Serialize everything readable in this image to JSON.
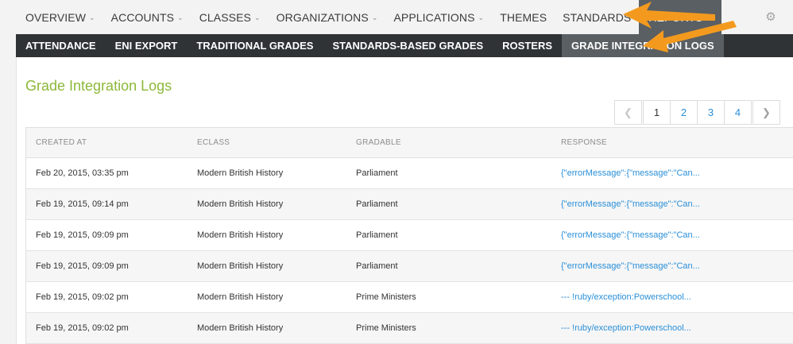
{
  "top_nav": {
    "items": [
      {
        "label": "OVERVIEW",
        "chevron": true
      },
      {
        "label": "ACCOUNTS",
        "chevron": true
      },
      {
        "label": "CLASSES",
        "chevron": true
      },
      {
        "label": "ORGANIZATIONS",
        "chevron": true
      },
      {
        "label": "APPLICATIONS",
        "chevron": true
      },
      {
        "label": "THEMES",
        "chevron": false
      },
      {
        "label": "STANDARDS",
        "chevron": false
      },
      {
        "label": "REPORTS",
        "chevron": true,
        "active": true
      }
    ],
    "settings_icon": "gear-icon"
  },
  "sub_nav": {
    "items": [
      {
        "label": "ATTENDANCE"
      },
      {
        "label": "ENI EXPORT"
      },
      {
        "label": "TRADITIONAL GRADES"
      },
      {
        "label": "STANDARDS-BASED GRADES"
      },
      {
        "label": "ROSTERS"
      },
      {
        "label": "GRADE INTEGRATION LOGS",
        "active": true
      }
    ]
  },
  "page": {
    "title": "Grade Integration Logs"
  },
  "pagination": {
    "prev_icon": "chevron-left-icon",
    "pages": [
      "1",
      "2",
      "3",
      "4"
    ],
    "current": "1",
    "next_icon": "chevron-right-icon"
  },
  "table": {
    "headers": [
      "CREATED AT",
      "ECLASS",
      "GRADABLE",
      "RESPONSE"
    ],
    "rows": [
      [
        "Feb 20, 2015, 03:35 pm",
        "Modern British History",
        "Parliament",
        "{\"errorMessage\":{\"message\":\"Can..."
      ],
      [
        "Feb 19, 2015, 09:14 pm",
        "Modern British History",
        "Parliament",
        "{\"errorMessage\":{\"message\":\"Can..."
      ],
      [
        "Feb 19, 2015, 09:09 pm",
        "Modern British History",
        "Parliament",
        "{\"errorMessage\":{\"message\":\"Can..."
      ],
      [
        "Feb 19, 2015, 09:09 pm",
        "Modern British History",
        "Parliament",
        "{\"errorMessage\":{\"message\":\"Can..."
      ],
      [
        "Feb 19, 2015, 09:02 pm",
        "Modern British History",
        "Prime Ministers",
        "--- !ruby/exception:Powerschool..."
      ],
      [
        "Feb 19, 2015, 09:02 pm",
        "Modern British History",
        "Prime Ministers",
        "--- !ruby/exception:Powerschool..."
      ]
    ]
  },
  "colors": {
    "title_green": "#8cb83a",
    "link_blue": "#2a8fd8",
    "active_tab": "#5a5f63",
    "subnav_bg": "#2f3336",
    "annotation_arrow": "#f39a1e"
  }
}
